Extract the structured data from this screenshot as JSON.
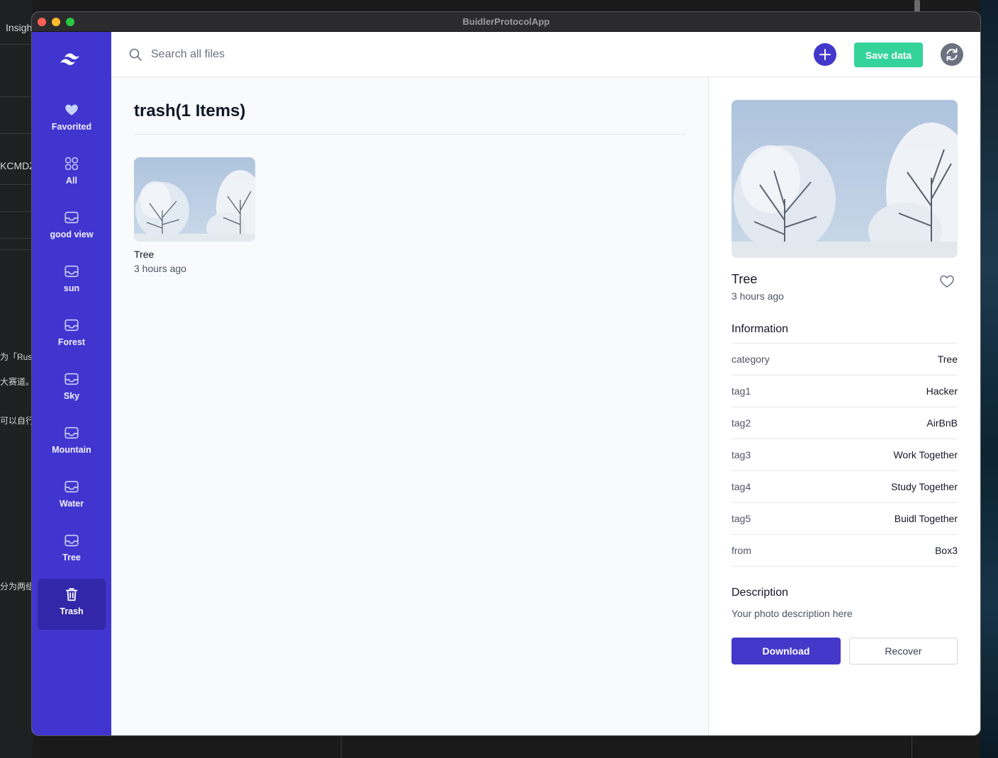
{
  "window": {
    "title": "BuidlerProtocolApp"
  },
  "background_text": {
    "items": [
      "Insigh",
      "KCMDZ",
      "为「Rus",
      "大赛道。元",
      "可以自行",
      "分为两组。"
    ]
  },
  "sidebar": {
    "logo_icon": "tailwind-logo-icon",
    "items": [
      {
        "label": "Favorited",
        "icon": "heart-icon"
      },
      {
        "label": "All",
        "icon": "grid-icon"
      },
      {
        "label": "good view",
        "icon": "inbox-icon"
      },
      {
        "label": "sun",
        "icon": "inbox-icon"
      },
      {
        "label": "Forest",
        "icon": "inbox-icon"
      },
      {
        "label": "Sky",
        "icon": "inbox-icon"
      },
      {
        "label": "Mountain",
        "icon": "inbox-icon"
      },
      {
        "label": "Water",
        "icon": "inbox-icon"
      },
      {
        "label": "Tree",
        "icon": "inbox-icon"
      },
      {
        "label": "Trash",
        "icon": "trash-icon",
        "active": true
      }
    ]
  },
  "header": {
    "search_placeholder": "Search all files",
    "save_label": "Save data",
    "add_icon": "plus-icon",
    "refresh_icon": "refresh-icon"
  },
  "main": {
    "title": "trash(1 Items)",
    "files": [
      {
        "name": "Tree",
        "time": "3 hours ago"
      }
    ]
  },
  "detail": {
    "name": "Tree",
    "time": "3 hours ago",
    "information_heading": "Information",
    "information": [
      {
        "key": "category",
        "value": "Tree"
      },
      {
        "key": "tag1",
        "value": "Hacker"
      },
      {
        "key": "tag2",
        "value": "AirBnB"
      },
      {
        "key": "tag3",
        "value": "Work Together"
      },
      {
        "key": "tag4",
        "value": "Study Together"
      },
      {
        "key": "tag5",
        "value": "Buidl Together"
      },
      {
        "key": "from",
        "value": "Box3"
      }
    ],
    "description_heading": "Description",
    "description": "Your photo description here",
    "download_label": "Download",
    "recover_label": "Recover"
  },
  "colors": {
    "sidebar": "#4135cf",
    "sidebar_active": "#3127a8",
    "accent": "#4338ca",
    "save": "#34d399"
  }
}
